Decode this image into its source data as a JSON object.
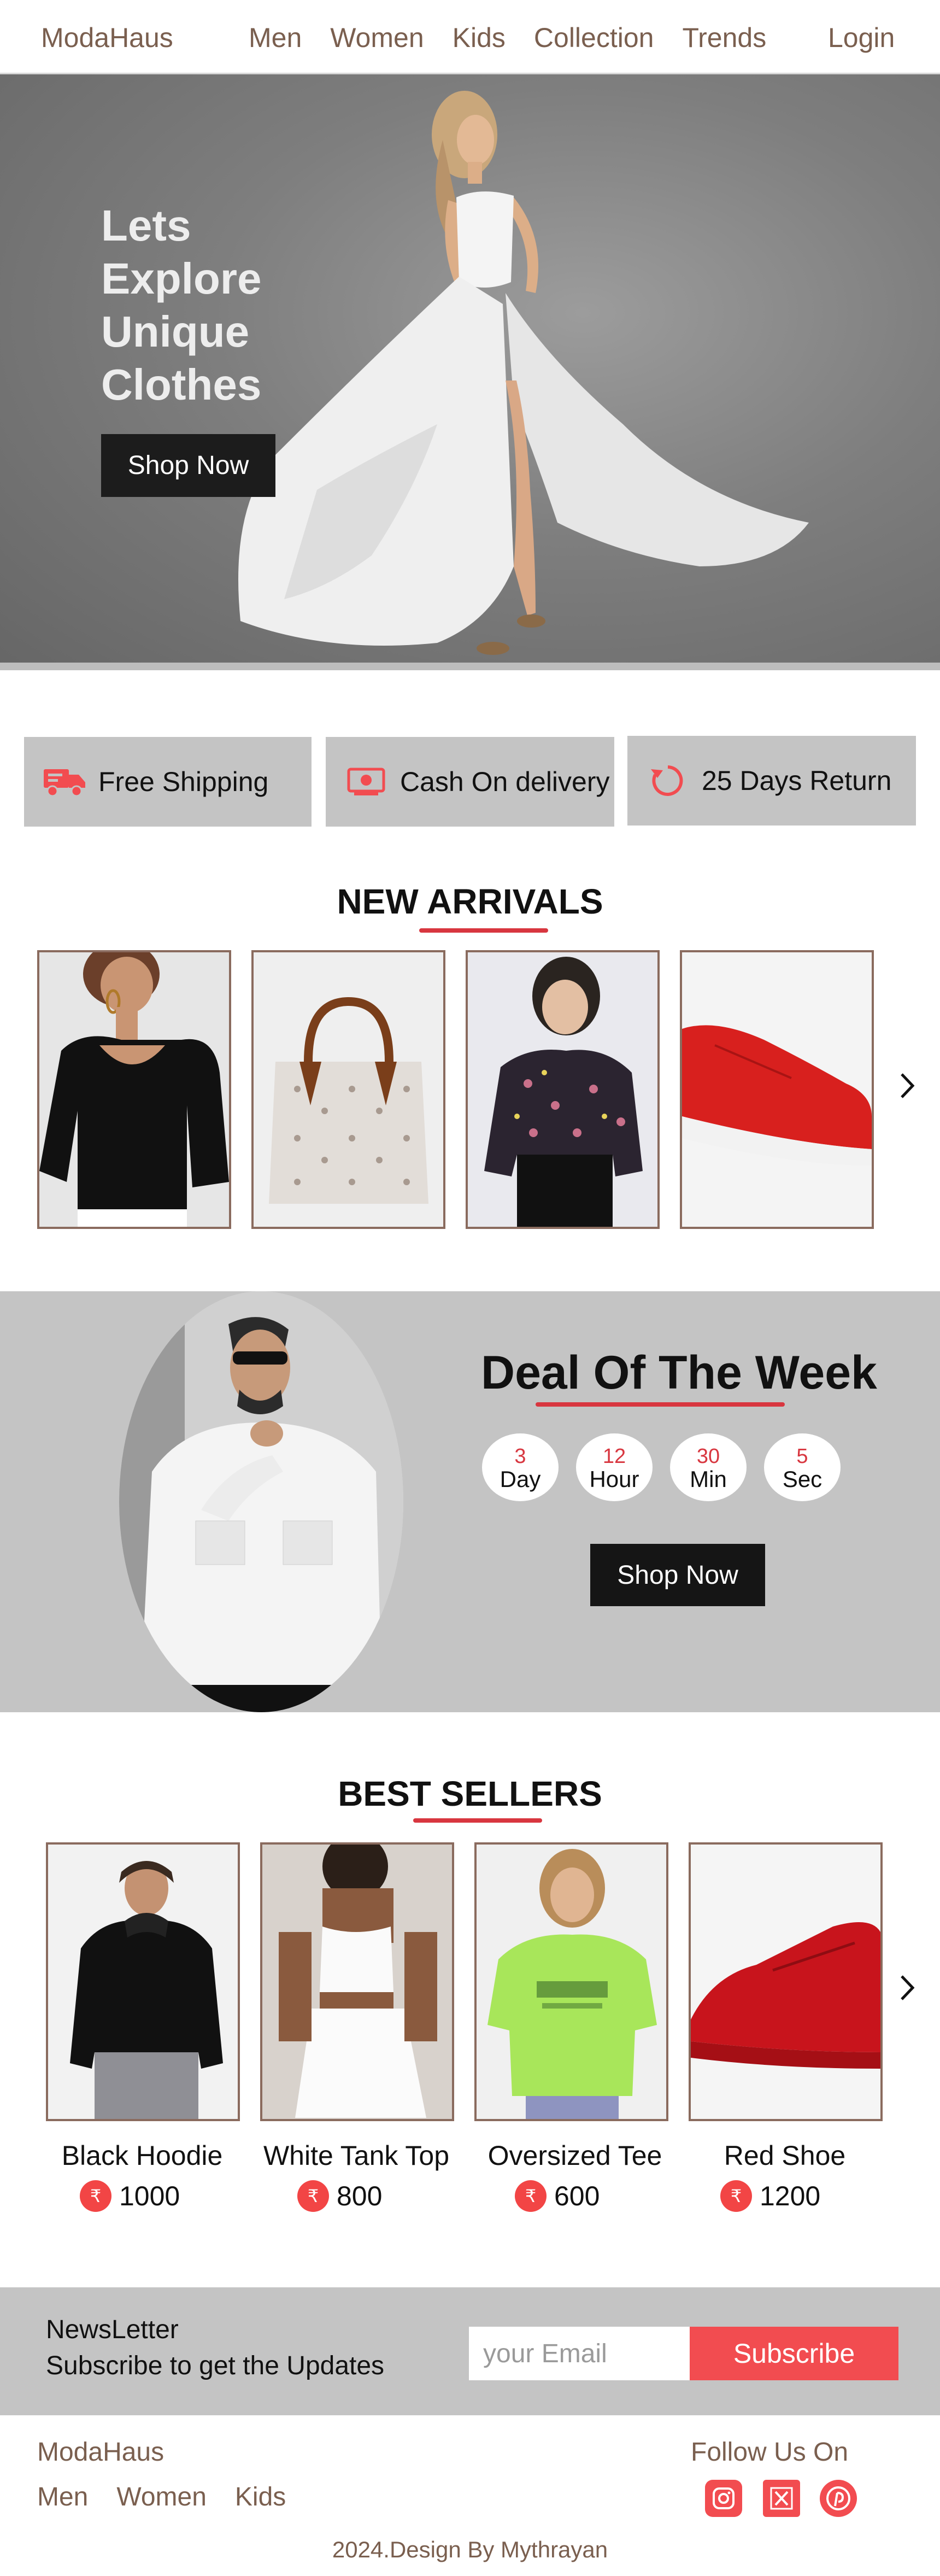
{
  "nav": {
    "brand": "ModaHaus",
    "links": [
      "Men",
      "Women",
      "Kids",
      "Collection",
      "Trends"
    ],
    "login": "Login"
  },
  "hero": {
    "headline": "Lets Explore Unique Clothes",
    "button": "Shop Now"
  },
  "features": [
    {
      "label": "Free Shipping",
      "icon": "truck-icon"
    },
    {
      "label": "Cash On delivery",
      "icon": "cash-icon"
    },
    {
      "label": "25 Days Return",
      "icon": "return-icon"
    }
  ],
  "new_arrivals": {
    "title": "NEW ARRIVALS",
    "items": [
      "black-puff-sleeve-top-image",
      "monogram-tote-bag-image",
      "floral-blouse-image",
      "red-sneaker-image"
    ],
    "next_icon": "chevron-right-icon"
  },
  "deal": {
    "title": "Deal Of The Week",
    "countdown": [
      {
        "value": "3",
        "unit": "Day"
      },
      {
        "value": "12",
        "unit": "Hour"
      },
      {
        "value": "30",
        "unit": "Min"
      },
      {
        "value": "5",
        "unit": "Sec"
      }
    ],
    "button": "Shop Now"
  },
  "best_sellers": {
    "title": "BEST SELLERS",
    "currency_symbol": "₹",
    "items": [
      {
        "name": "Black Hoodie",
        "price": "1000"
      },
      {
        "name": "White Tank Top",
        "price": "800"
      },
      {
        "name": "Oversized Tee",
        "price": "600"
      },
      {
        "name": "Red Shoe",
        "price": "1200"
      }
    ],
    "next_icon": "chevron-right-icon"
  },
  "newsletter": {
    "heading": "NewsLetter",
    "subheading": "Subscribe to get the Updates",
    "placeholder": "your Email",
    "button": "Subscribe"
  },
  "footer": {
    "brand": "ModaHaus",
    "links": [
      "Men",
      "Women",
      "Kids"
    ],
    "follow": "Follow Us On",
    "socials": [
      "instagram-icon",
      "x-icon",
      "pinterest-icon"
    ],
    "copyright": "2024.Design By Mythrayan"
  },
  "colors": {
    "accent": "#f24c50",
    "underline": "#d8363f",
    "nav_text": "#7a5f4f",
    "band_gray": "#c4c4c4",
    "card_border": "#8a6b5e",
    "dark_button": "#1c1c1c"
  }
}
